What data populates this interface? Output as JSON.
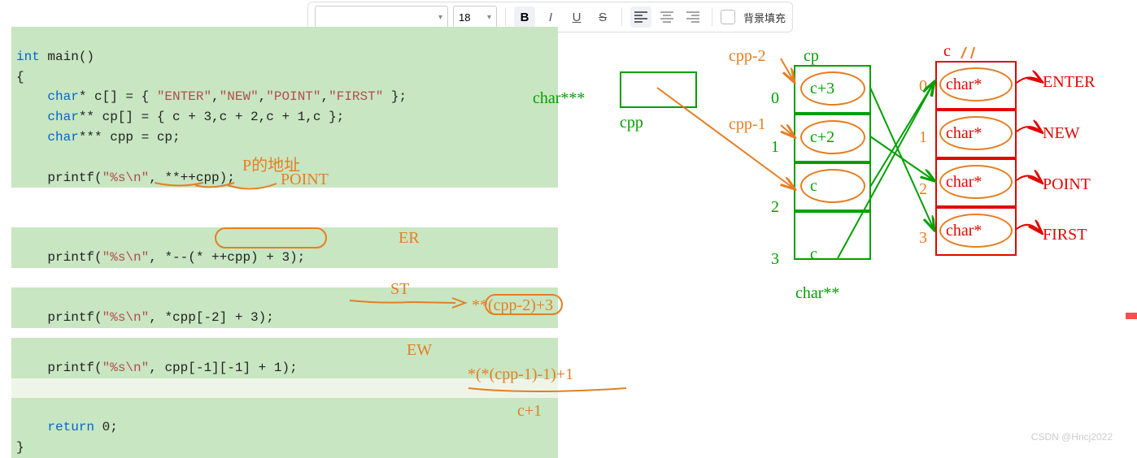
{
  "toolbar": {
    "font_value": "",
    "size_value": "18",
    "bold": "B",
    "italic": "I",
    "underline": "U",
    "strike": "S",
    "bg_fill_label": "背景填充"
  },
  "code": {
    "block1_pre": "int",
    "block1_main": " main()\n{\n    ",
    "char": "char",
    "block1_l1_rest": "* c[] = { ",
    "s_enter": "\"ENTER\"",
    "s_new": "\"NEW\"",
    "s_point": "\"POINT\"",
    "s_first": "\"FIRST\"",
    "block1_l1_end": " };",
    "block1_l2_rest": "** cp[] = { c + 3,c + 2,c + 1,c };",
    "block1_l3_rest": "*** cpp = cp;",
    "block1_blank": "",
    "printf1_a": "    printf(",
    "fmt": "\"%s\\n\"",
    "printf1_b": ", **++cpp);",
    "printf2": "    printf(",
    "printf2_b": ", *--(* ++cpp) + 3);",
    "printf3_b": ", *cpp[-2] + 3);",
    "printf4_b": ", cpp[-1][-1] + 1);",
    "ret_pre": "    ",
    "ret_kw": "return",
    "ret_post": " 0;\n}"
  },
  "annotations": {
    "p_addr": "P的地址",
    "point": "POINT",
    "er": "ER",
    "st": "ST",
    "st_expr": "**(cpp-2)+3",
    "ew": "EW",
    "ew_expr": "*(*(cpp-1)-1)+1",
    "c1": "c+1"
  },
  "diagram": {
    "char3": "char***",
    "cpp": "cpp",
    "cpp_m2": "cpp-2",
    "cpp_m1": "cpp-1",
    "cp": "cp",
    "idx0": "0",
    "idx1": "1",
    "idx2": "2",
    "idx3": "3",
    "cell0": "c+3",
    "cell1": "c+2",
    "cell2": "c",
    "cell3": "c",
    "char2": "char**",
    "c": "c",
    "charstar": "char*",
    "enter": "ENTER",
    "new": "NEW",
    "point": "POINT",
    "first": "FIRST",
    "ridx0": "0",
    "ridx1": "1",
    "ridx2": "2",
    "ridx3": "3"
  },
  "watermark": "CSDN @Hncj2022"
}
